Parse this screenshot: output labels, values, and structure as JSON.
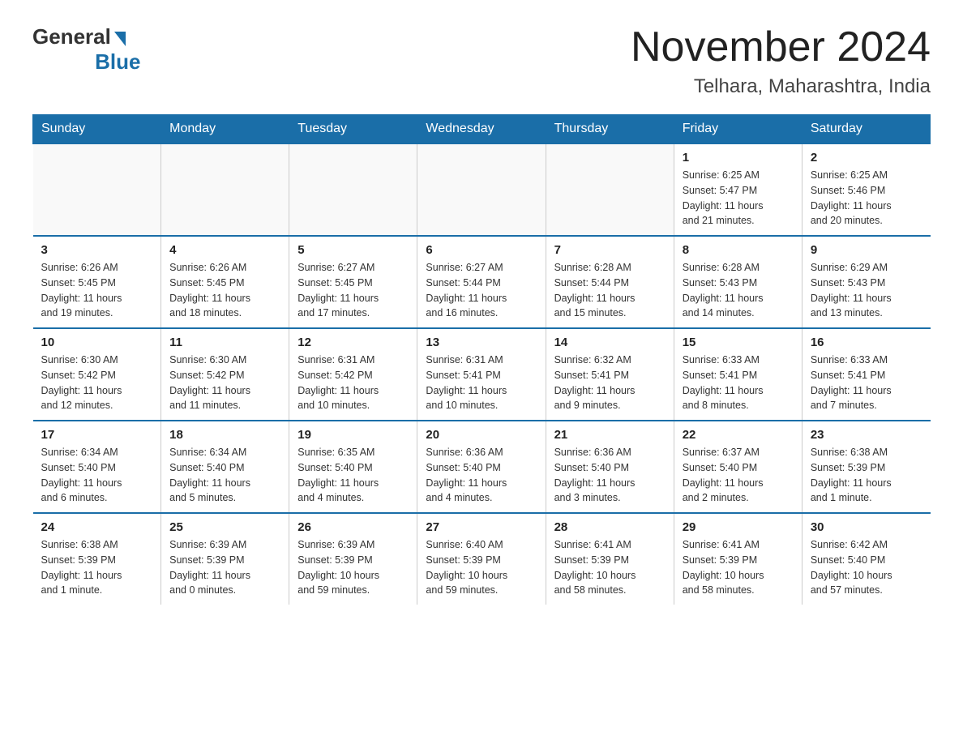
{
  "logo": {
    "general": "General",
    "blue": "Blue"
  },
  "header": {
    "month": "November 2024",
    "location": "Telhara, Maharashtra, India"
  },
  "weekdays": [
    "Sunday",
    "Monday",
    "Tuesday",
    "Wednesday",
    "Thursday",
    "Friday",
    "Saturday"
  ],
  "weeks": [
    [
      {
        "day": "",
        "info": ""
      },
      {
        "day": "",
        "info": ""
      },
      {
        "day": "",
        "info": ""
      },
      {
        "day": "",
        "info": ""
      },
      {
        "day": "",
        "info": ""
      },
      {
        "day": "1",
        "info": "Sunrise: 6:25 AM\nSunset: 5:47 PM\nDaylight: 11 hours\nand 21 minutes."
      },
      {
        "day": "2",
        "info": "Sunrise: 6:25 AM\nSunset: 5:46 PM\nDaylight: 11 hours\nand 20 minutes."
      }
    ],
    [
      {
        "day": "3",
        "info": "Sunrise: 6:26 AM\nSunset: 5:45 PM\nDaylight: 11 hours\nand 19 minutes."
      },
      {
        "day": "4",
        "info": "Sunrise: 6:26 AM\nSunset: 5:45 PM\nDaylight: 11 hours\nand 18 minutes."
      },
      {
        "day": "5",
        "info": "Sunrise: 6:27 AM\nSunset: 5:45 PM\nDaylight: 11 hours\nand 17 minutes."
      },
      {
        "day": "6",
        "info": "Sunrise: 6:27 AM\nSunset: 5:44 PM\nDaylight: 11 hours\nand 16 minutes."
      },
      {
        "day": "7",
        "info": "Sunrise: 6:28 AM\nSunset: 5:44 PM\nDaylight: 11 hours\nand 15 minutes."
      },
      {
        "day": "8",
        "info": "Sunrise: 6:28 AM\nSunset: 5:43 PM\nDaylight: 11 hours\nand 14 minutes."
      },
      {
        "day": "9",
        "info": "Sunrise: 6:29 AM\nSunset: 5:43 PM\nDaylight: 11 hours\nand 13 minutes."
      }
    ],
    [
      {
        "day": "10",
        "info": "Sunrise: 6:30 AM\nSunset: 5:42 PM\nDaylight: 11 hours\nand 12 minutes."
      },
      {
        "day": "11",
        "info": "Sunrise: 6:30 AM\nSunset: 5:42 PM\nDaylight: 11 hours\nand 11 minutes."
      },
      {
        "day": "12",
        "info": "Sunrise: 6:31 AM\nSunset: 5:42 PM\nDaylight: 11 hours\nand 10 minutes."
      },
      {
        "day": "13",
        "info": "Sunrise: 6:31 AM\nSunset: 5:41 PM\nDaylight: 11 hours\nand 10 minutes."
      },
      {
        "day": "14",
        "info": "Sunrise: 6:32 AM\nSunset: 5:41 PM\nDaylight: 11 hours\nand 9 minutes."
      },
      {
        "day": "15",
        "info": "Sunrise: 6:33 AM\nSunset: 5:41 PM\nDaylight: 11 hours\nand 8 minutes."
      },
      {
        "day": "16",
        "info": "Sunrise: 6:33 AM\nSunset: 5:41 PM\nDaylight: 11 hours\nand 7 minutes."
      }
    ],
    [
      {
        "day": "17",
        "info": "Sunrise: 6:34 AM\nSunset: 5:40 PM\nDaylight: 11 hours\nand 6 minutes."
      },
      {
        "day": "18",
        "info": "Sunrise: 6:34 AM\nSunset: 5:40 PM\nDaylight: 11 hours\nand 5 minutes."
      },
      {
        "day": "19",
        "info": "Sunrise: 6:35 AM\nSunset: 5:40 PM\nDaylight: 11 hours\nand 4 minutes."
      },
      {
        "day": "20",
        "info": "Sunrise: 6:36 AM\nSunset: 5:40 PM\nDaylight: 11 hours\nand 4 minutes."
      },
      {
        "day": "21",
        "info": "Sunrise: 6:36 AM\nSunset: 5:40 PM\nDaylight: 11 hours\nand 3 minutes."
      },
      {
        "day": "22",
        "info": "Sunrise: 6:37 AM\nSunset: 5:40 PM\nDaylight: 11 hours\nand 2 minutes."
      },
      {
        "day": "23",
        "info": "Sunrise: 6:38 AM\nSunset: 5:39 PM\nDaylight: 11 hours\nand 1 minute."
      }
    ],
    [
      {
        "day": "24",
        "info": "Sunrise: 6:38 AM\nSunset: 5:39 PM\nDaylight: 11 hours\nand 1 minute."
      },
      {
        "day": "25",
        "info": "Sunrise: 6:39 AM\nSunset: 5:39 PM\nDaylight: 11 hours\nand 0 minutes."
      },
      {
        "day": "26",
        "info": "Sunrise: 6:39 AM\nSunset: 5:39 PM\nDaylight: 10 hours\nand 59 minutes."
      },
      {
        "day": "27",
        "info": "Sunrise: 6:40 AM\nSunset: 5:39 PM\nDaylight: 10 hours\nand 59 minutes."
      },
      {
        "day": "28",
        "info": "Sunrise: 6:41 AM\nSunset: 5:39 PM\nDaylight: 10 hours\nand 58 minutes."
      },
      {
        "day": "29",
        "info": "Sunrise: 6:41 AM\nSunset: 5:39 PM\nDaylight: 10 hours\nand 58 minutes."
      },
      {
        "day": "30",
        "info": "Sunrise: 6:42 AM\nSunset: 5:40 PM\nDaylight: 10 hours\nand 57 minutes."
      }
    ]
  ]
}
